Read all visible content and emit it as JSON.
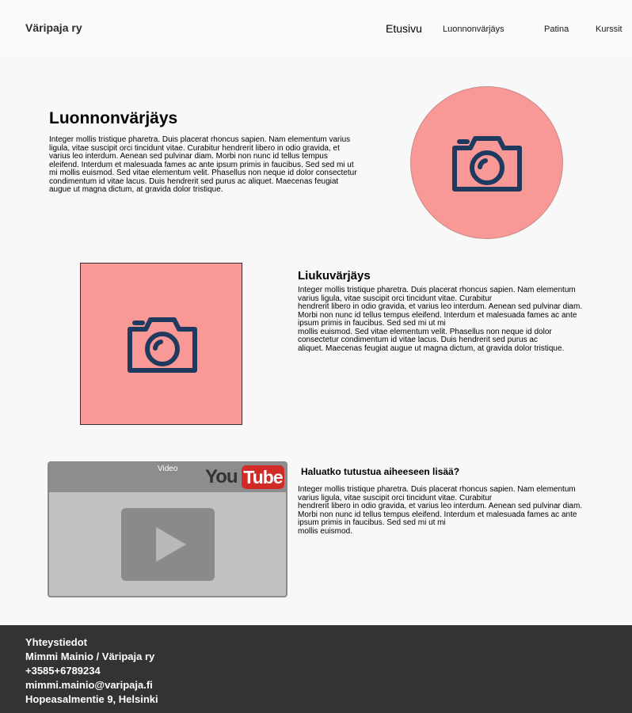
{
  "navbar": {
    "brand": "Väripaja ry",
    "links": [
      "Etusivu",
      "Luonnonvärjäys",
      "Patina",
      "Kurssit"
    ]
  },
  "section1": {
    "title": "Luonnonvärjäys",
    "text": "Integer mollis tristique pharetra. Duis placerat rhoncus sapien. Nam elementum varius ligula, vitae suscipit orci tincidunt vitae. Curabitur hendrerit libero in odio gravida, et varius leo interdum. Aenean sed pulvinar diam. Morbi non nunc id tellus tempus eleifend. Interdum et malesuada fames ac ante ipsum primis in faucibus. Sed sed mi ut mi mollis euismod. Sed vitae elementum velit. Phasellus non neque id dolor consectetur condimentum id vitae lacus. Duis hendrerit sed purus ac aliquet. Maecenas feugiat augue ut magna dictum, at gravida dolor tristique."
  },
  "section2": {
    "title": "Liukuvärjäys",
    "lines": [
      "Integer mollis tristique pharetra. Duis placerat rhoncus sapien. Nam elementum varius ligula, vitae suscipit orci tincidunt vitae. Curabitur",
      "hendrerit libero in odio gravida, et varius leo interdum. Aenean sed pulvinar diam. Morbi non nunc id tellus tempus eleifend. Interdum et malesuada fames ac ante ipsum primis in faucibus. Sed sed mi ut mi",
      "mollis euismod. Sed vitae elementum velit. Phasellus non neque id dolor",
      "consectetur condimentum id vitae lacus. Duis hendrerit sed purus ac",
      "aliquet. Maecenas feugiat augue ut magna dictum, at gravida dolor tristique."
    ]
  },
  "section3": {
    "video_label": "Video",
    "yt_you": "You",
    "yt_tube": "Tube",
    "title": "Haluatko tutustua aiheeseen lisää?",
    "lines": [
      "Integer mollis tristique pharetra. Duis placerat rhoncus sapien. Nam elementum varius ligula, vitae suscipit orci tincidunt vitae. Curabitur",
      "hendrerit libero in odio gravida, et varius leo interdum. Aenean sed pulvinar diam. Morbi non nunc id tellus tempus eleifend. Interdum et malesuada fames ac ante ipsum primis in faucibus. Sed sed mi ut mi",
      "mollis euismod."
    ]
  },
  "footer": {
    "heading": "Yhteystiedot",
    "name": "Mimmi Mainio / Väripaja ry",
    "phone": "+3585+6789234",
    "email": "mimmi.mainio@varipaja.fi",
    "address": "Hopeasalmentie 9, Helsinki"
  },
  "icons": {
    "camera": "camera-icon",
    "play": "play-icon",
    "youtube": "youtube-logo"
  },
  "colors": {
    "placeholder": "#f99997",
    "camera": "#1e3a5f",
    "footer": "#333333"
  }
}
